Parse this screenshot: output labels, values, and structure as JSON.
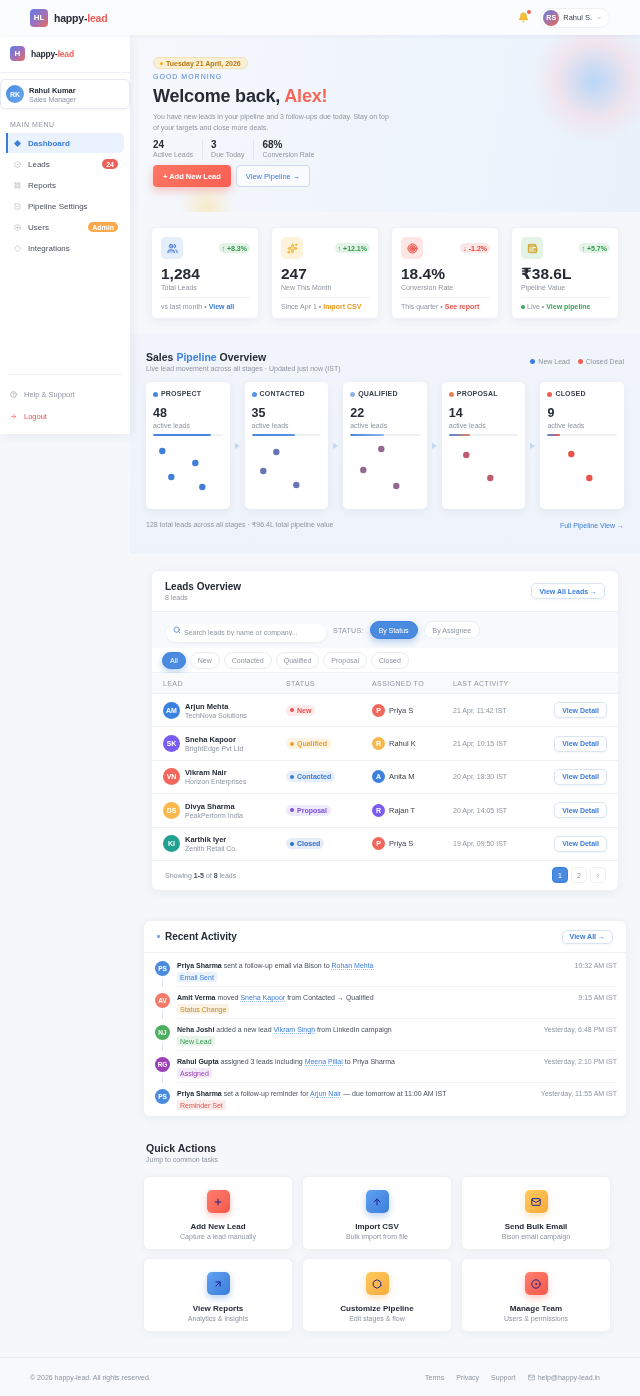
{
  "header": {
    "logo_initials": "HL",
    "brand_start": "happy-",
    "brand_accent": "lead",
    "notifications_unread": true,
    "user": {
      "initials": "RS",
      "name": "Rahul S."
    }
  },
  "sidebar": {
    "logo_initials": "H",
    "brand_start": "happy-",
    "brand_accent": "lead",
    "profile": {
      "initials": "RK",
      "name": "Rahul Kumar",
      "role": "Sales Manager"
    },
    "section_label": "MAIN MENU",
    "items": [
      {
        "kind": "dashboard",
        "label": "Dashboard",
        "selected": true
      },
      {
        "kind": "leads",
        "label": "Leads",
        "selected": false,
        "badge": {
          "text": "24",
          "color": "#f0605a"
        }
      },
      {
        "kind": "reports",
        "label": "Reports",
        "selected": false
      },
      {
        "kind": "pipeline",
        "label": "Pipeline Settings",
        "selected": false
      },
      {
        "kind": "users",
        "label": "Users",
        "selected": false,
        "badge": {
          "text": "Admin",
          "color": "#fba94c"
        }
      },
      {
        "kind": "integrations",
        "label": "Integrations",
        "selected": false
      }
    ],
    "footer_items": [
      {
        "kind": "help",
        "label": "Help & Support"
      },
      {
        "kind": "logout",
        "label": "Logout"
      }
    ]
  },
  "hero": {
    "date": "Tuesday 21 April, 2026",
    "greeting": "GOOD MORNING",
    "title": "Welcome back,",
    "name": "Alex!",
    "message": "You have new leads in your pipeline and 3 follow-ups due today. Stay on top of your targets and close more deals.",
    "stats": [
      {
        "value": "24",
        "label": "Active Leads"
      },
      {
        "value": "3",
        "label": "Due Today"
      },
      {
        "value": "68%",
        "label": "Conversion Rate"
      }
    ],
    "primary_action": "+ Add New Lead",
    "secondary_action": "View Pipeline →"
  },
  "stat_cards": [
    {
      "kind": "leads",
      "value": "1,284",
      "label": "Total Leads",
      "rising": true,
      "change": "↑ +8.3%",
      "note": "vs last month •",
      "link": "View all"
    },
    {
      "kind": "new",
      "value": "247",
      "label": "New This Month",
      "rising": true,
      "change": "↑ +12.1%",
      "note": "Since Apr 1 •",
      "link": "Import CSV"
    },
    {
      "kind": "conversion",
      "value": "18.4%",
      "label": "Conversion Rate",
      "rising": false,
      "change": "↓ -1.2%",
      "note": "This quarter •",
      "link": "See report"
    },
    {
      "kind": "value",
      "value": "₹38.6L",
      "label": "Pipeline Value",
      "rising": true,
      "change": "↑ +5.7%",
      "note": "Live •",
      "link": "View pipeline"
    }
  ],
  "pipeline": {
    "title_start": "Sales",
    "title_accent": "Pipeline",
    "title_end": "Overview",
    "subtitle": "Live lead movement across all stages · Updated just now (IST)",
    "legend": [
      {
        "label": "New Lead",
        "color": "#3b7ddd"
      },
      {
        "label": "Closed Deal",
        "color": "#f0605a"
      }
    ],
    "stages": [
      {
        "name": "PROSPECT",
        "count": "48",
        "caption": "active leads",
        "level": 0.84,
        "color": "#4a86e0"
      },
      {
        "name": "CONTACTED",
        "count": "35",
        "caption": "active leads",
        "level": 0.63,
        "color": "#5a94e4"
      },
      {
        "name": "QUALIFIED",
        "count": "22",
        "caption": "active leads",
        "level": 0.48,
        "color": "#8fb4ea"
      },
      {
        "name": "PROPOSAL",
        "count": "14",
        "caption": "active leads",
        "level": 0.31,
        "color": "#e8845a"
      },
      {
        "name": "CLOSED",
        "count": "9",
        "caption": "active leads",
        "level": 0.18,
        "color": "#ef5a50"
      }
    ],
    "summary": "128 total leads across all stages · ₹96.4L total pipeline value",
    "link": "Full Pipeline View →"
  },
  "leads": {
    "title": "Leads Overview",
    "count": "8 leads",
    "view_all": "View All Leads →",
    "search_placeholder": "Search leads by name or company...",
    "group_label": "STATUS:",
    "group_options": [
      {
        "label": "By Status",
        "selected": true
      },
      {
        "label": "By Assignee",
        "selected": false
      }
    ],
    "filters": [
      {
        "label": "All",
        "selected": true
      },
      {
        "label": "New",
        "selected": false
      },
      {
        "label": "Contacted",
        "selected": false
      },
      {
        "label": "Qualified",
        "selected": false
      },
      {
        "label": "Proposal",
        "selected": false
      },
      {
        "label": "Closed",
        "selected": false
      }
    ],
    "columns": [
      "LEAD",
      "STATUS",
      "ASSIGNED TO",
      "LAST ACTIVITY"
    ],
    "rows": [
      {
        "lead": {
          "initials": "AM",
          "name": "Arjun Mehta",
          "company": "TechNova Solutions",
          "color": "#3b82e0"
        },
        "status": {
          "label": "New",
          "color": "#ef4f4f"
        },
        "assignee": {
          "initial": "P",
          "name": "Priya S",
          "color": "#f2675b"
        },
        "last_activity": "21 Apr, 11:42 IST",
        "action": "View Detail"
      },
      {
        "lead": {
          "initials": "SK",
          "name": "Sneha Kapoor",
          "company": "BrightEdge Pvt Ltd",
          "color": "#7b5cf0"
        },
        "status": {
          "label": "Qualified",
          "color": "#eea020"
        },
        "assignee": {
          "initial": "R",
          "name": "Rahul K",
          "color": "#f8b84e"
        },
        "last_activity": "21 Apr, 10:15 IST",
        "action": "View Detail"
      },
      {
        "lead": {
          "initials": "VN",
          "name": "Vikram Nair",
          "company": "Horizon Enterprises",
          "color": "#f2675b"
        },
        "status": {
          "label": "Contacted",
          "color": "#3b7dd8"
        },
        "assignee": {
          "initial": "A",
          "name": "Anita M",
          "color": "#3b82e0"
        },
        "last_activity": "20 Apr, 18:30 IST",
        "action": "View Detail"
      },
      {
        "lead": {
          "initials": "DS",
          "name": "Divya Sharma",
          "company": "PeakPerform India",
          "color": "#f8b84e"
        },
        "status": {
          "label": "Proposal",
          "color": "#7b4fe0"
        },
        "assignee": {
          "initial": "R",
          "name": "Rajan T",
          "color": "#7b5cf0"
        },
        "last_activity": "20 Apr, 14:05 IST",
        "action": "View Detail"
      },
      {
        "lead": {
          "initials": "KI",
          "name": "Karthik Iyer",
          "company": "Zenith Retail Co.",
          "color": "#20a090"
        },
        "status": {
          "label": "Closed",
          "color": "#2f6fc8"
        },
        "assignee": {
          "initial": "P",
          "name": "Priya S",
          "color": "#f2675b"
        },
        "last_activity": "19 Apr, 09:50 IST",
        "action": "View Detail"
      }
    ],
    "summary": "Showing **1-5** of **8** leads",
    "pages": [
      {
        "label": "1",
        "selected": true
      },
      {
        "label": "2",
        "selected": false
      }
    ],
    "next": "›"
  },
  "activity": {
    "title": "Recent Activity",
    "view_all": "View All →",
    "items": [
      {
        "initials": "PS",
        "color": "#4a8be0",
        "text_before": "**Priya Sharma** sent a follow-up email via Bison to ",
        "link": "Rohan Mehta",
        "tag": {
          "label": "Email Sent",
          "kind": "email"
        },
        "time": "10:32 AM IST"
      },
      {
        "initials": "AV",
        "color": "#f47a6a",
        "text_before": "**Amit Verma** moved ",
        "link": "Sneha Kapoor",
        "text_after": " from Contacted → Qualified",
        "tag": {
          "label": "Status Change",
          "kind": "status"
        },
        "time": "9:15 AM IST"
      },
      {
        "initials": "NJ",
        "color": "#4caf60",
        "text_before": "**Neha Joshi** added a new lead ",
        "link": "Vikram Singh",
        "text_after": " from LinkedIn campaign",
        "tag": {
          "label": "New Lead",
          "kind": "lead"
        },
        "time": "Yesterday, 6:48 PM IST"
      },
      {
        "initials": "RG",
        "color": "#9c3fb8",
        "text_before": "**Rahul Gupta** assigned 3 leads including ",
        "link": "Meena Pillai",
        "text_after": " to Priya Sharma",
        "tag": {
          "label": "Assigned",
          "kind": "assigned"
        },
        "time": "Yesterday, 2:10 PM IST"
      },
      {
        "initials": "PS",
        "color": "#4a8be0",
        "text_before": "**Priya Sharma** set a follow-up reminder for ",
        "link": "Arjun Nair",
        "text_after": " — due tomorrow at 11:00 AM IST",
        "tag": {
          "label": "Reminder Set",
          "kind": "reminder"
        },
        "time": "Yesterday, 11:55 AM IST"
      }
    ]
  },
  "quick_actions": {
    "title": "Quick Actions",
    "subtitle": "Jump to common tasks",
    "items": [
      {
        "kind": "add",
        "title": "Add New Lead",
        "subtitle": "Capture a lead manually"
      },
      {
        "kind": "import",
        "title": "Import CSV",
        "subtitle": "Bulk import from file"
      },
      {
        "kind": "email",
        "title": "Send Bulk Email",
        "subtitle": "Bison email campaign"
      },
      {
        "kind": "reports",
        "title": "View Reports",
        "subtitle": "Analytics & insights"
      },
      {
        "kind": "pipeline",
        "title": "Customize Pipeline",
        "subtitle": "Edit stages & flow"
      },
      {
        "kind": "team",
        "title": "Manage Team",
        "subtitle": "Users & permissions"
      }
    ]
  },
  "footer": {
    "copyright": "© 2026 happy-lead. All rights reserved.",
    "links": [
      "Terms",
      "Privacy",
      "Support"
    ],
    "email": "help@happy-lead.in"
  }
}
